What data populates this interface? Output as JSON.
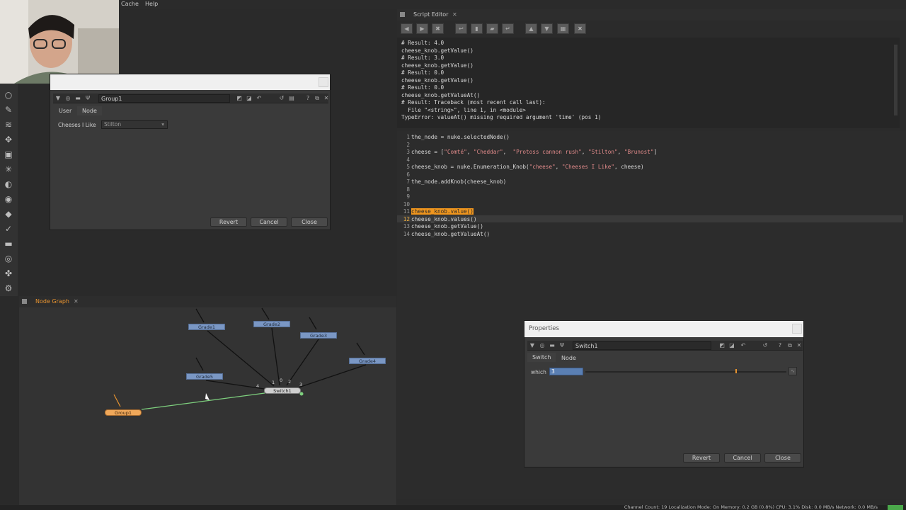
{
  "menu": {
    "items": [
      "Cache",
      "Help"
    ]
  },
  "group_panel": {
    "node_name": "Group1",
    "tabs": [
      "User",
      "Node"
    ],
    "knob_label": "Cheeses I Like",
    "knob_value": "Stilton",
    "buttons": {
      "revert": "Revert",
      "cancel": "Cancel",
      "close": "Close"
    }
  },
  "script_editor": {
    "tab_label": "Script Editor",
    "output_lines": [
      "# Result: 4.0",
      "cheese_knob.getValue()",
      "# Result: 3.0",
      "cheese_knob.getValue()",
      "# Result: 0.0",
      "cheese_knob.getValue()",
      "# Result: 0.0",
      "cheese_knob.getValueAt()",
      "# Result: Traceback (most recent call last):",
      "  File \"<string>\", line 1, in <module>",
      "TypeError: valueAt() missing required argument 'time' (pos 1)"
    ],
    "code": {
      "l1": "the_node = nuke.selectedNode()",
      "l3_a": "cheese = [",
      "l3_s1": "\"Comté\"",
      "l3_sep1": ", ",
      "l3_s2": "\"Cheddar\"",
      "l3_sep2": ",  ",
      "l3_s3": "\"Protoss cannon rush\"",
      "l3_sep3": ", ",
      "l3_s4": "\"Stilton\"",
      "l3_sep4": ", ",
      "l3_s5": "\"Brunost\"",
      "l3_end": "]",
      "l5_a": "cheese_knob = nuke.Enumeration_Knob(",
      "l5_s1": "\"cheese\"",
      "l5_sep": ", ",
      "l5_s2": "\"Cheeses I Like\"",
      "l5_end": ", cheese)",
      "l7": "the_node.addKnob(cheese_knob)",
      "l11": "cheese_knob.value()",
      "l12": "cheese_knob.values()",
      "l13": "cheese_knob.getValue()",
      "l14": "cheese_knob.getValueAt()"
    },
    "line_numbers": [
      "1",
      "2",
      "3",
      "4",
      "5",
      "6",
      "7",
      "8",
      "9",
      "10",
      "11",
      "12",
      "13",
      "14"
    ]
  },
  "node_graph": {
    "tab_label": "Node Graph",
    "nodes": {
      "grade1": "Grade1",
      "grade2": "Grade2",
      "grade3": "Grade3",
      "grade4": "Grade4",
      "grade5": "Grade5",
      "switch1": "Switch1",
      "group1": "Group1"
    },
    "input_labels": [
      "1",
      "0",
      "2",
      "3",
      "4"
    ]
  },
  "properties": {
    "title": "Properties",
    "node_name": "Switch1",
    "tabs": [
      "Switch",
      "Node"
    ],
    "knob_label": "which",
    "knob_value": "3",
    "buttons": {
      "revert": "Revert",
      "cancel": "Cancel",
      "close": "Close"
    }
  },
  "status_bar": {
    "text": "Channel Count: 19  Localization Mode: On  Memory: 0.2 GB (0.8%)  CPU: 3.1%  Disk: 0.0 MB/s  Network: 0.0 MB/s"
  }
}
